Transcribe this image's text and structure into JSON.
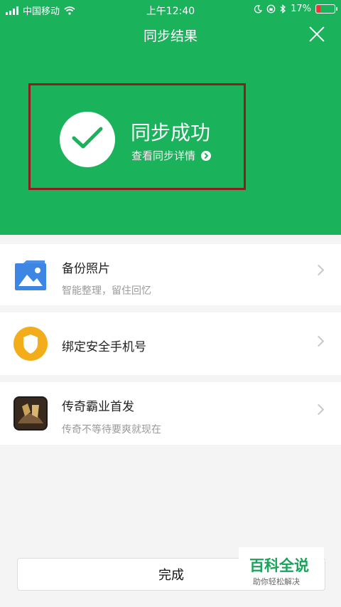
{
  "status_bar": {
    "carrier": "中国移动",
    "time": "上午12:40",
    "battery": "17%"
  },
  "header": {
    "title": "同步结果"
  },
  "result": {
    "status": "同步成功",
    "details_link": "查看同步详情"
  },
  "items": [
    {
      "title": "备份照片",
      "subtitle": "智能整理，留住回忆",
      "icon": "photo-icon"
    },
    {
      "title": "绑定安全手机号",
      "subtitle": "",
      "icon": "shield-icon"
    },
    {
      "title": "传奇霸业首发",
      "subtitle": "传奇不等待要爽就现在",
      "icon": "game-icon"
    }
  ],
  "footer": {
    "done_label": "完成"
  },
  "watermark": {
    "title": "百科全说",
    "subtitle": "助你轻松解决"
  }
}
